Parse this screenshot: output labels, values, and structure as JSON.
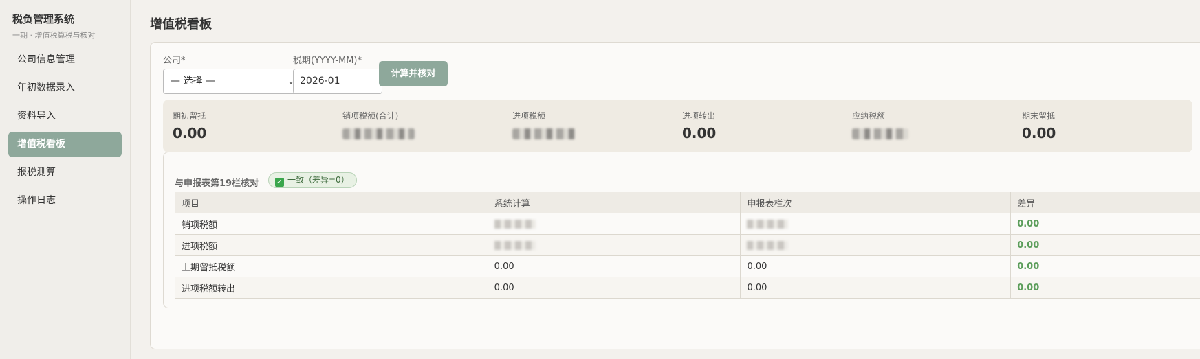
{
  "sidebar": {
    "title": "税负管理系统",
    "subtitle": "一期 · 增值税算税与核对",
    "items": [
      {
        "label": "公司信息管理"
      },
      {
        "label": "年初数据录入"
      },
      {
        "label": "资料导入"
      },
      {
        "label": "增值税看板"
      },
      {
        "label": "报税测算"
      },
      {
        "label": "操作日志"
      }
    ]
  },
  "main": {
    "title": "增值税看板",
    "company_label": "公司*",
    "company_value": "— 选择 —",
    "period_label": "税期(YYYY-MM)*",
    "period_value": "2026-01",
    "calc_button": "计算并核对"
  },
  "stats": [
    {
      "label": "期初留抵",
      "value": "0.00"
    },
    {
      "label": "销项税额(合计)",
      "value": ""
    },
    {
      "label": "进项税额",
      "value": ""
    },
    {
      "label": "进项转出",
      "value": "0.00"
    },
    {
      "label": "应纳税额",
      "value": ""
    },
    {
      "label": "期末留抵",
      "value": "0.00"
    }
  ],
  "reconcile": {
    "title": "与申报表第19栏核对",
    "badge": "一致（差异=0）",
    "columns": [
      "项目",
      "系统计算",
      "申报表栏次",
      "差异"
    ],
    "rows": [
      {
        "item": "销项税额",
        "system": "",
        "declared": "",
        "diff": "0.00"
      },
      {
        "item": "进项税额",
        "system": "",
        "declared": "",
        "diff": "0.00"
      },
      {
        "item": "上期留抵税额",
        "system": "0.00",
        "declared": "0.00",
        "diff": "0.00"
      },
      {
        "item": "进项税额转出",
        "system": "0.00",
        "declared": "0.00",
        "diff": "0.00"
      }
    ]
  },
  "colors": {
    "accent": "#8ea89b",
    "ok_green": "#5b9d5a"
  }
}
